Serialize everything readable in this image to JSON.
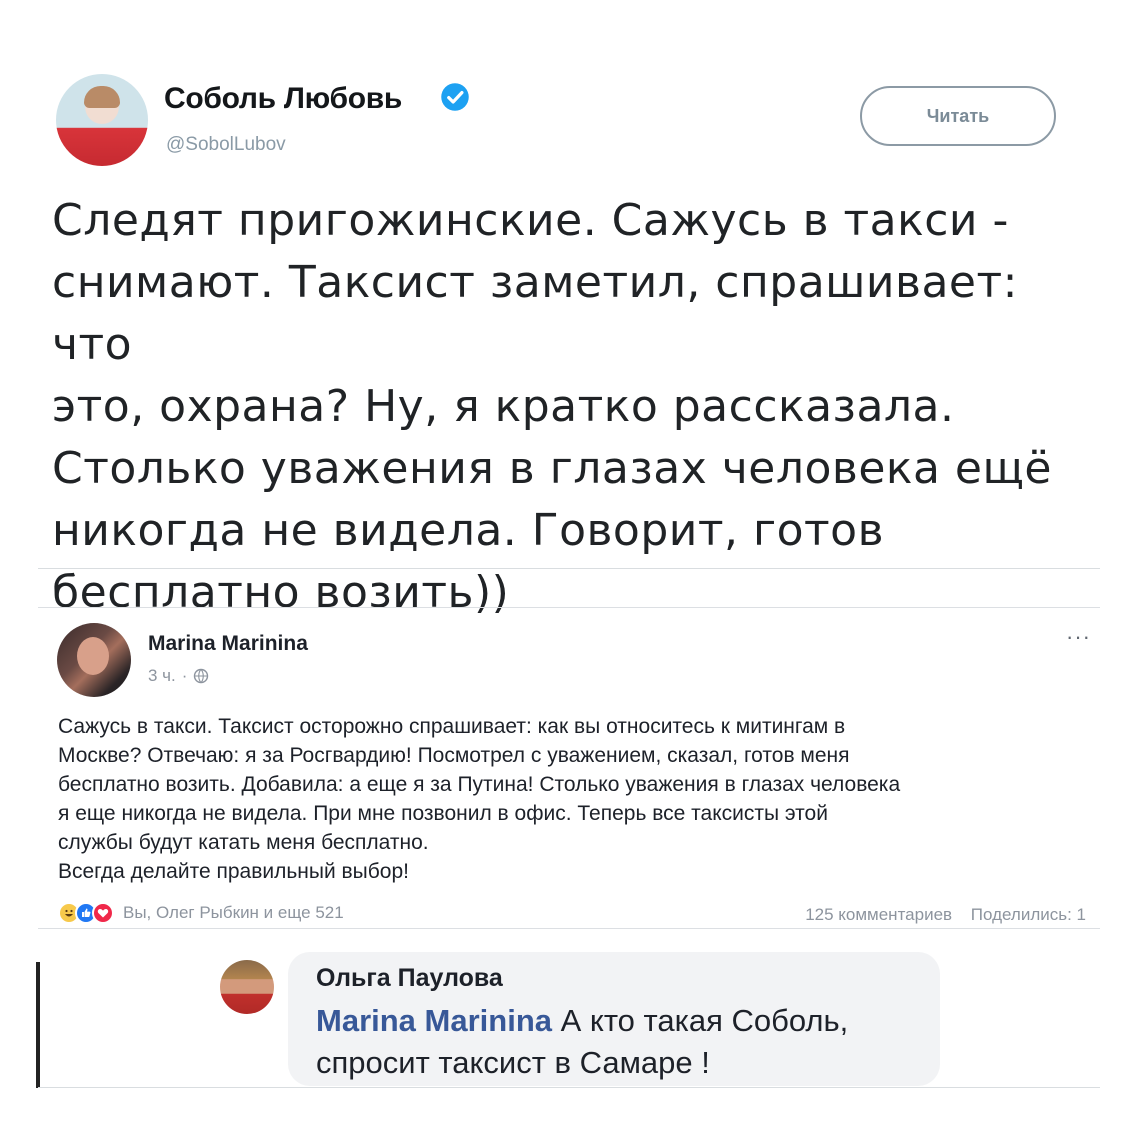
{
  "twitter": {
    "name": "Соболь Любовь",
    "handle": "@SobolLubov",
    "follow_label": "Читать",
    "tweet_text": "Следят пригожинские. Сажусь в такси -\nснимают. Таксист заметил, спрашивает: что\nэто, охрана? Ну, я кратко рассказала.\nСтолько уважения в глазах человека ещё\nникогда не видела. Говорит, готов\nбесплатно возить))"
  },
  "facebook": {
    "author": "Marina Marinina",
    "time": "3 ч.",
    "separator": "·",
    "post_text": "Сажусь в такси. Таксист осторожно спрашивает: как вы относитесь к митингам в\nМоскве? Отвечаю: я за Росгвардию! Посмотрел с уважением, сказал, готов меня\nбесплатно возить. Добавила: а еще я за Путина! Столько уважения в глазах человека\nя еще никогда не видела. При мне позвонил в офис. Теперь все таксисты этой\nслужбы будут катать меня бесплатно.\nВсегда делайте правильный выбор!",
    "reactions_text": "Вы, Олег Рыбкин и еще 521",
    "comments_count": "125 комментариев",
    "shares_count": "Поделились: 1",
    "more_label": "···"
  },
  "comment": {
    "author": "Ольга Паулова",
    "mention": "Marina Marinina",
    "text": " А кто такая Соболь, спросит таксист в Самаре !"
  },
  "colors": {
    "twitter_verified": "#1da1f2",
    "facebook_link": "#385898",
    "muted_text": "#8d949e",
    "like_blue": "#2078f4",
    "love_red": "#f0284a",
    "haha_yellow": "#f7c94b"
  }
}
